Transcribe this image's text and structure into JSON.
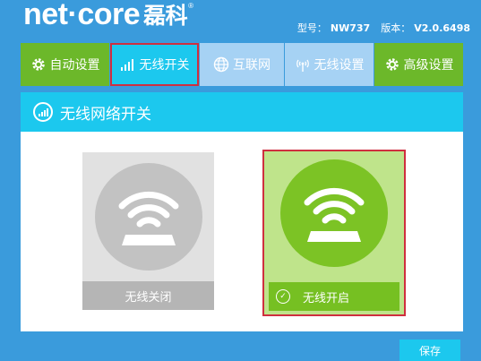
{
  "header": {
    "brand": "net·core",
    "brand_cn": "磊科",
    "registered_mark": "®",
    "model_label": "型号：",
    "model_value": "NW737",
    "version_label": "版本：",
    "version_value": "V2.0.6498"
  },
  "nav": {
    "tabs": [
      {
        "label": "自动设置",
        "icon": "gear-icon",
        "state": "normal",
        "color": "#6cb82a"
      },
      {
        "label": "无线开关",
        "icon": "signal-bars-icon",
        "state": "active",
        "color": "#1cc8ee"
      },
      {
        "label": "互联网",
        "icon": "globe-icon",
        "state": "normal",
        "color": "#a6d2f4"
      },
      {
        "label": "无线设置",
        "icon": "antenna-icon",
        "state": "normal",
        "color": "#a6d2f4"
      },
      {
        "label": "高级设置",
        "icon": "gear-icon",
        "state": "normal",
        "color": "#6cb82a"
      }
    ]
  },
  "panel": {
    "title": "无线网络开关",
    "title_icon": "signal-bars-icon"
  },
  "options": {
    "off": {
      "label": "无线关闭",
      "selected": false,
      "icon": "wifi-router-icon",
      "color": "#c2c2c2"
    },
    "on": {
      "label": "无线开启",
      "selected": true,
      "icon": "wifi-router-icon",
      "check_icon": "check-circle-icon",
      "color": "#7cc325"
    }
  },
  "actions": {
    "save_label": "保存"
  },
  "colors": {
    "background": "#3a9bdc",
    "accent": "#1cc8ee",
    "green": "#6cb82a",
    "highlight": "#cf2f3f"
  }
}
